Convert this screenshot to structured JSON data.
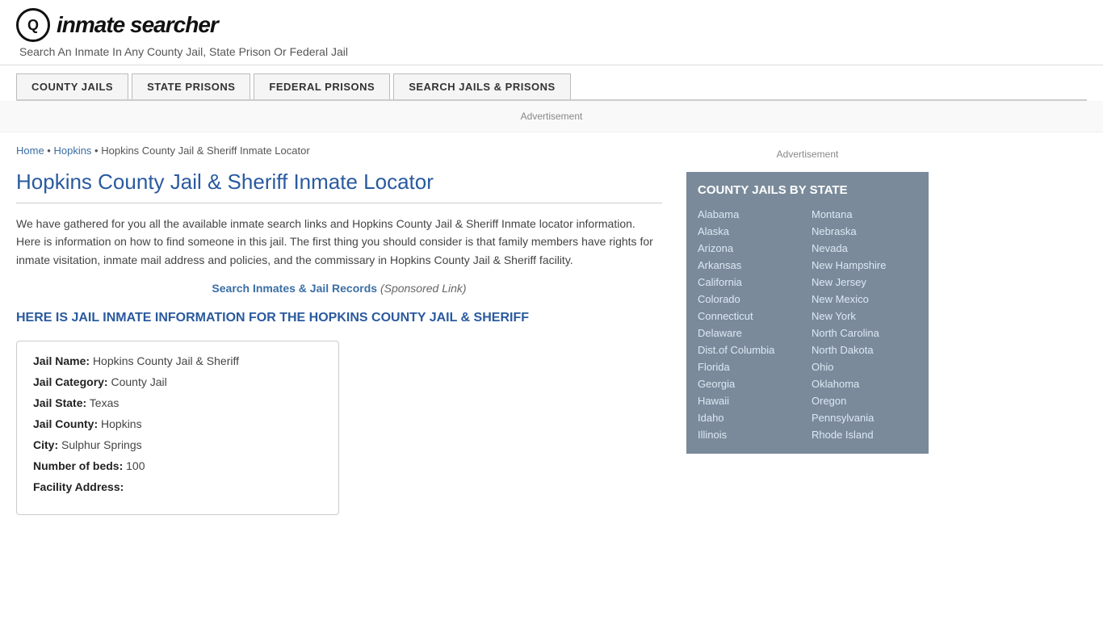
{
  "header": {
    "logo_letter": "Q",
    "logo_name": "inmate searcher",
    "tagline": "Search An Inmate In Any County Jail, State Prison Or Federal Jail"
  },
  "nav": {
    "buttons": [
      {
        "label": "COUNTY JAILS",
        "name": "county-jails-btn"
      },
      {
        "label": "STATE PRISONS",
        "name": "state-prisons-btn"
      },
      {
        "label": "FEDERAL PRISONS",
        "name": "federal-prisons-btn"
      },
      {
        "label": "SEARCH JAILS & PRISONS",
        "name": "search-jails-btn"
      }
    ]
  },
  "ad_label": "Advertisement",
  "breadcrumb": {
    "home": "Home",
    "separator1": " • ",
    "link2": "Hopkins",
    "separator2": " • ",
    "current": "Hopkins County Jail & Sheriff Inmate Locator"
  },
  "page_title": "Hopkins County Jail & Sheriff Inmate Locator",
  "description": "We have gathered for you all the available inmate search links and Hopkins County Jail & Sheriff Inmate locator information. Here is information on how to find someone in this jail. The first thing you should consider is that family members have rights for inmate visitation, inmate mail address and policies, and the commissary in Hopkins County Jail & Sheriff facility.",
  "sponsored": {
    "link_text": "Search Inmates & Jail Records",
    "label": "(Sponsored Link)"
  },
  "jail_info_header": "HERE IS JAIL INMATE INFORMATION FOR THE HOPKINS COUNTY JAIL & SHERIFF",
  "jail_details": {
    "jail_name_label": "Jail Name:",
    "jail_name": "Hopkins County Jail & Sheriff",
    "jail_category_label": "Jail Category:",
    "jail_category": "County Jail",
    "jail_state_label": "Jail State:",
    "jail_state": "Texas",
    "jail_county_label": "Jail County:",
    "jail_county": "Hopkins",
    "city_label": "City:",
    "city": "Sulphur Springs",
    "num_beds_label": "Number of beds:",
    "num_beds": "100",
    "facility_address_label": "Facility Address:"
  },
  "sidebar": {
    "ad_label": "Advertisement",
    "county_jails_title": "COUNTY JAILS BY STATE",
    "col1": [
      "Alabama",
      "Alaska",
      "Arizona",
      "Arkansas",
      "California",
      "Colorado",
      "Connecticut",
      "Delaware",
      "Dist.of Columbia",
      "Florida",
      "Georgia",
      "Hawaii",
      "Idaho",
      "Illinois"
    ],
    "col2": [
      "Montana",
      "Nebraska",
      "Nevada",
      "New Hampshire",
      "New Jersey",
      "New Mexico",
      "New York",
      "North Carolina",
      "North Dakota",
      "Ohio",
      "Oklahoma",
      "Oregon",
      "Pennsylvania",
      "Rhode Island"
    ]
  }
}
